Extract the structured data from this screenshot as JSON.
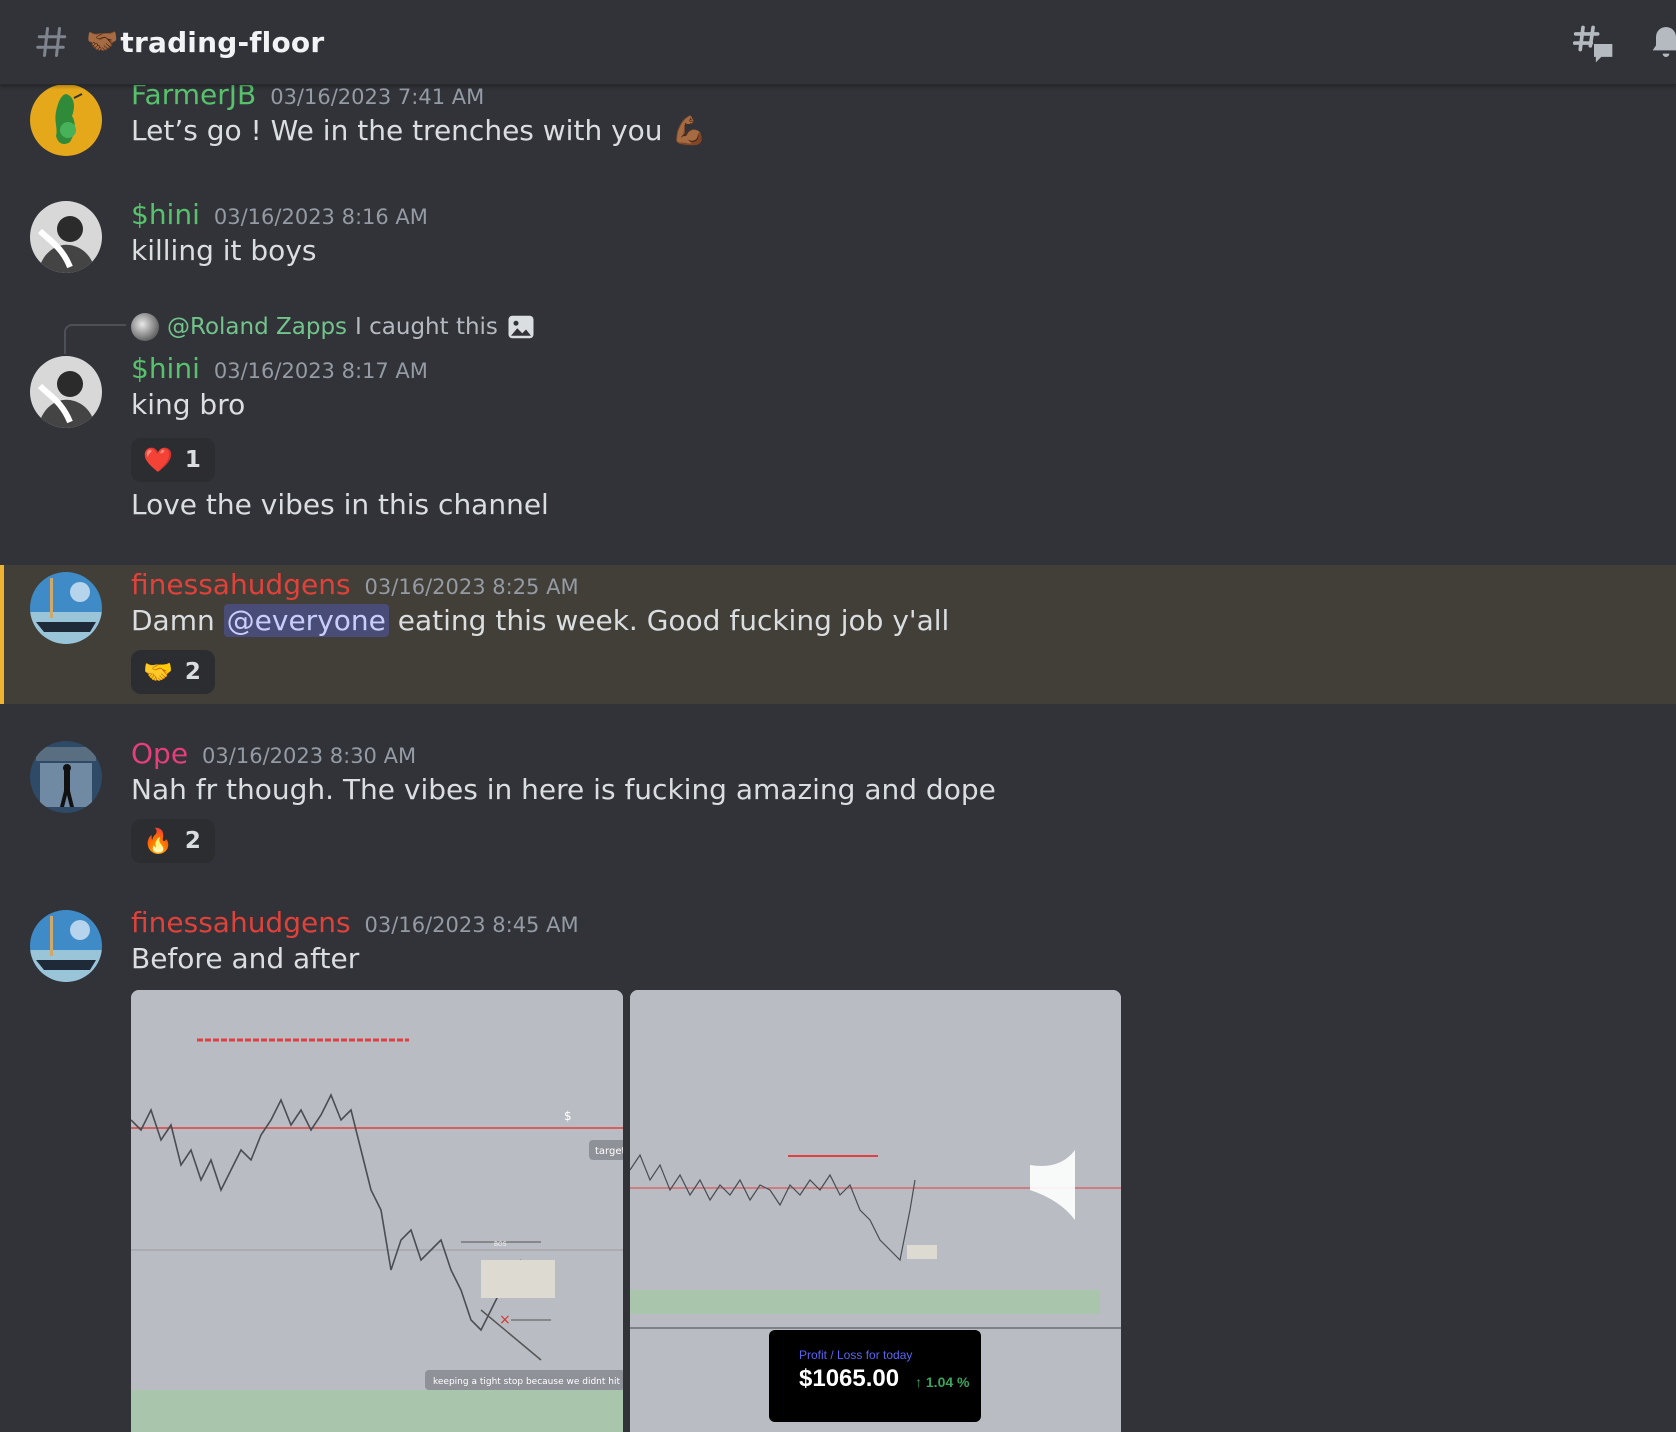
{
  "channel": {
    "emoji": "🤝🏾",
    "name": "trading-floor"
  },
  "colors": {
    "green_user": "#57c16c",
    "red_user": "#e0413a",
    "pink_user": "#e53e7a",
    "mention_bg": "#3c4270",
    "highlight_bg": "#413f37",
    "highlight_bar": "#f0b232"
  },
  "icons": [
    "hash-icon",
    "threads-icon",
    "bell-icon",
    "image-icon"
  ],
  "messages": [
    {
      "author": "FarmerJB",
      "timestamp": "03/16/2023 7:41 AM",
      "text": "Let’s go ! We in the trenches with you",
      "emoji": "💪🏾"
    },
    {
      "author": "$hini",
      "timestamp": "03/16/2023 8:16 AM",
      "text": "killing it boys"
    },
    {
      "reply_to": {
        "author": "@Roland Zapps",
        "text": "I caught this"
      },
      "author": "$hini",
      "timestamp": "03/16/2023 8:17 AM",
      "text": "king bro",
      "reaction": {
        "emoji": "❤️",
        "count": "1"
      },
      "followup": "Love the vibes in this channel"
    },
    {
      "author": "finessahudgens",
      "timestamp": "03/16/2023 8:25 AM",
      "text_before": "Damn",
      "mention": "@everyone",
      "text_after": "eating this week. Good fucking job y'all",
      "reaction": {
        "emoji": "🤝",
        "count": "2"
      }
    },
    {
      "author": "Ope",
      "timestamp": "03/16/2023 8:30 AM",
      "text": "Nah fr though. The vibes in here is fucking amazing and dope",
      "reaction": {
        "emoji": "🔥",
        "count": "2"
      }
    },
    {
      "author": "finessahudgens",
      "timestamp": "03/16/2023 8:45 AM",
      "text": "Before and after",
      "attachments": [
        {
          "annotations": [
            "$",
            "target",
            "BOS",
            "keeping a tight stop because we didnt hit dem"
          ]
        },
        {
          "pl_label": "Profit / Loss for today",
          "pl_value": "$1065.00",
          "pl_change": "↑ 1.04 %"
        }
      ]
    }
  ]
}
